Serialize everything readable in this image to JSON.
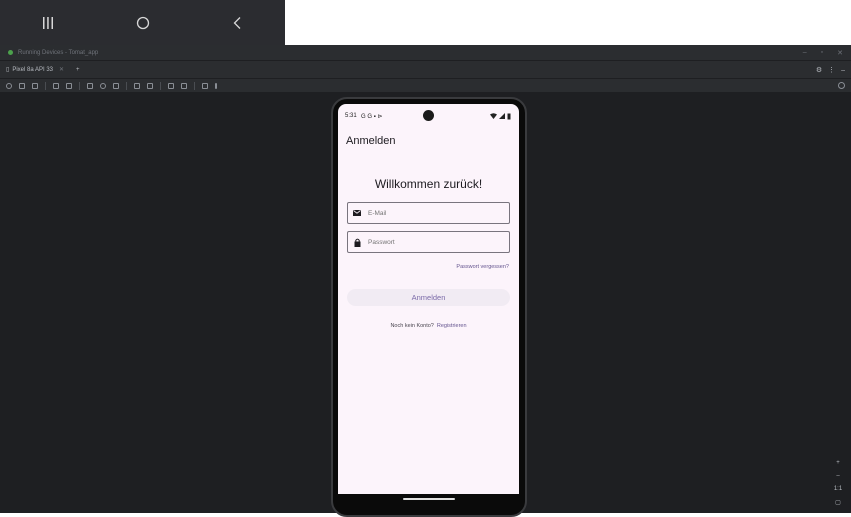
{
  "phone_nav": {
    "recents_icon": "recents-icon",
    "home_icon": "home-circle-icon",
    "back_icon": "back-chevron-icon"
  },
  "window": {
    "title": "Running Devices - Tomat_app",
    "status_dot_color": "#4ca14c"
  },
  "tabs": [
    {
      "label": "Pixel 8a API 33"
    }
  ],
  "phone": {
    "status": {
      "time": "5:31",
      "left_icons": "G G ▪ ⊳"
    },
    "app_title": "Anmelden",
    "welcome": "Willkommen zurück!",
    "email": {
      "placeholder": "E-Mail"
    },
    "password": {
      "placeholder": "Passwort"
    },
    "forgot": "Passwort vergessen?",
    "login_button": "Anmelden",
    "no_account": "Noch kein Konto?",
    "register_link": "Registrieren"
  },
  "zoom": {
    "ratio": "1:1"
  },
  "colors": {
    "accent": "#65558f",
    "screen_bg": "#fcf4fb"
  }
}
